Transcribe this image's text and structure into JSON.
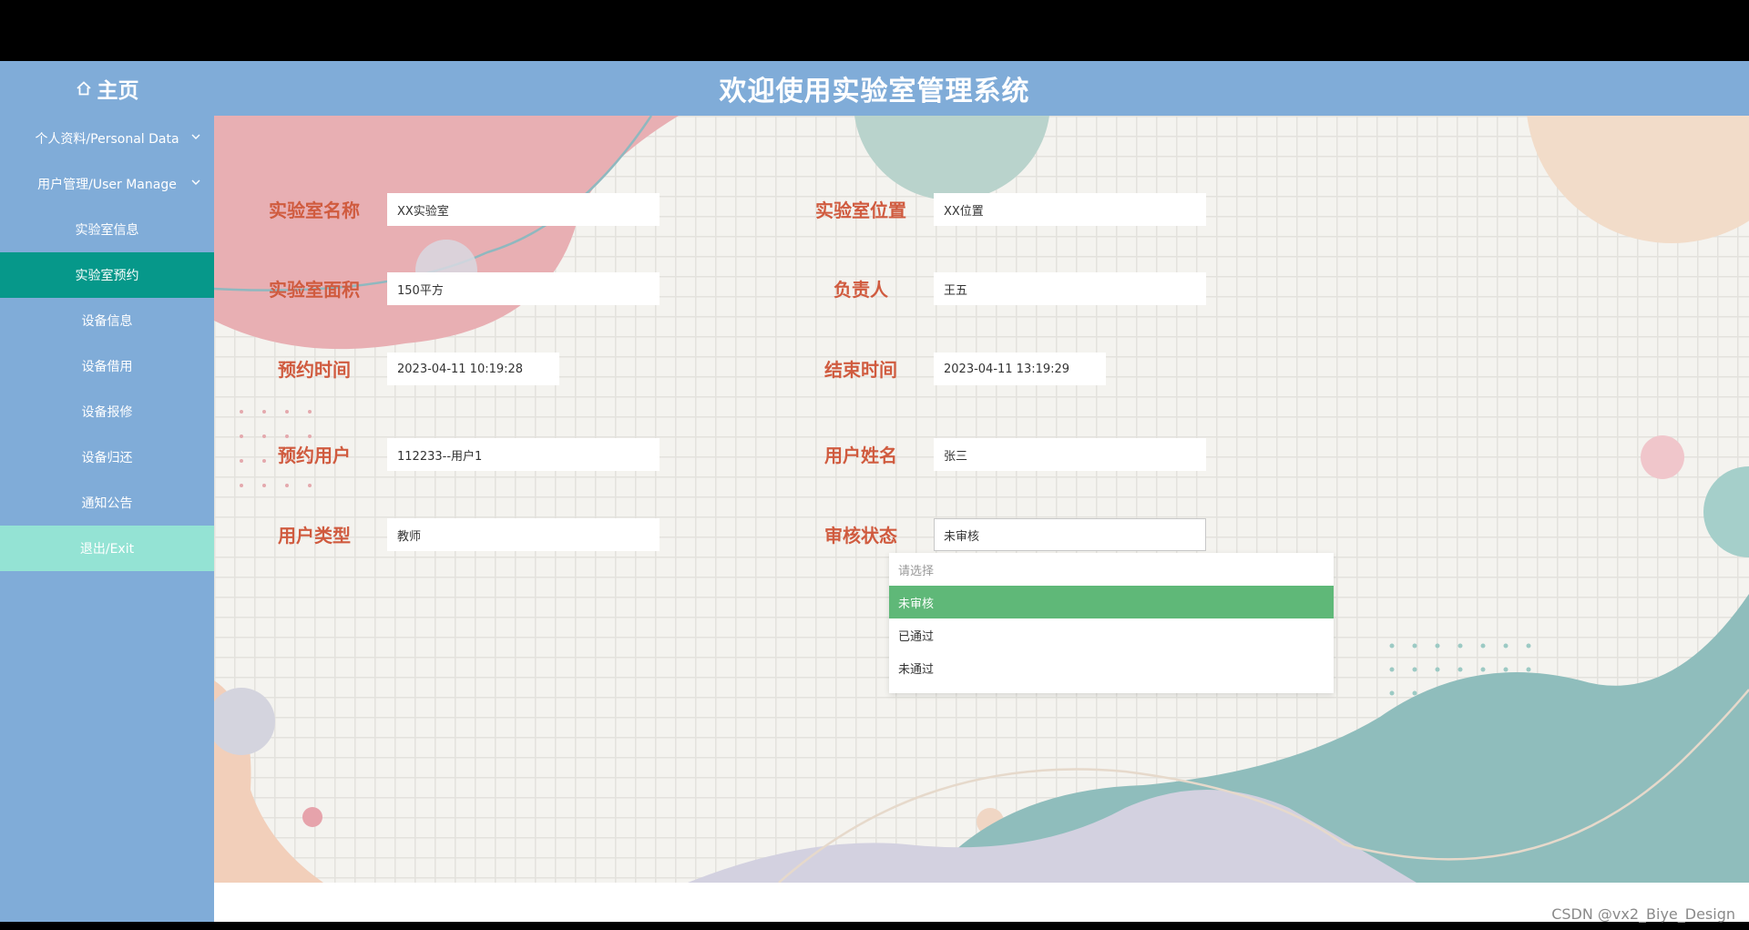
{
  "header": {
    "home_label": "主页",
    "system_title": "欢迎使用实验室管理系统"
  },
  "sidebar": {
    "items": [
      {
        "label": "个人资料/Personal Data"
      },
      {
        "label": "用户管理/User Manage"
      },
      {
        "label": "实验室信息"
      },
      {
        "label": "实验室预约"
      },
      {
        "label": "设备信息"
      },
      {
        "label": "设备借用"
      },
      {
        "label": "设备报修"
      },
      {
        "label": "设备归还"
      },
      {
        "label": "通知公告"
      },
      {
        "label": "退出/Exit"
      }
    ]
  },
  "form": {
    "lab_name": {
      "label": "实验室名称",
      "value": "XX实验室"
    },
    "lab_location": {
      "label": "实验室位置",
      "value": "XX位置"
    },
    "lab_area": {
      "label": "实验室面积",
      "value": "150平方"
    },
    "manager": {
      "label": "负责人",
      "value": "王五"
    },
    "reserve_time": {
      "label": "预约时间",
      "value": "2023-04-11 10:19:28"
    },
    "end_time": {
      "label": "结束时间",
      "value": "2023-04-11 13:19:29"
    },
    "reserve_user": {
      "label": "预约用户",
      "value": "112233--用户1"
    },
    "user_name": {
      "label": "用户姓名",
      "value": "张三"
    },
    "user_type": {
      "label": "用户类型",
      "value": "教师"
    },
    "review_status": {
      "label": "审核状态",
      "value": "未审核"
    }
  },
  "dropdown": {
    "placeholder": "请选择",
    "options": [
      "未审核",
      "已通过",
      "未通过"
    ]
  },
  "watermark": "CSDN @vx2_Biye_Design",
  "colors": {
    "header_bg": "#80acd8",
    "active_item": "#06988a",
    "exit_item": "#94e3d4",
    "label_text": "#d05b3f",
    "selected_option": "#5fb878"
  }
}
